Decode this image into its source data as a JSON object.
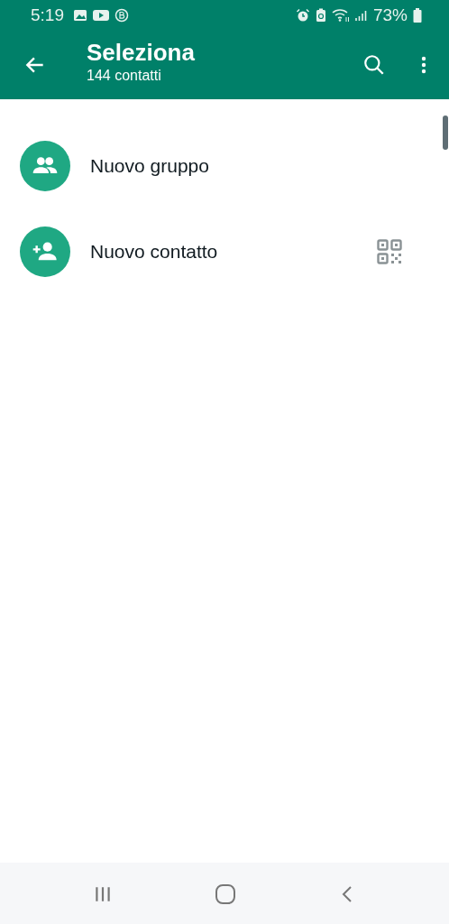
{
  "status_bar": {
    "time": "5:19",
    "battery": "73%"
  },
  "header": {
    "title": "Seleziona",
    "subtitle": "144 contatti"
  },
  "actions": [
    {
      "kind": "group",
      "label": "Nuovo gruppo",
      "qr": false
    },
    {
      "kind": "contact",
      "label": "Nuovo contatto",
      "qr": true
    }
  ]
}
